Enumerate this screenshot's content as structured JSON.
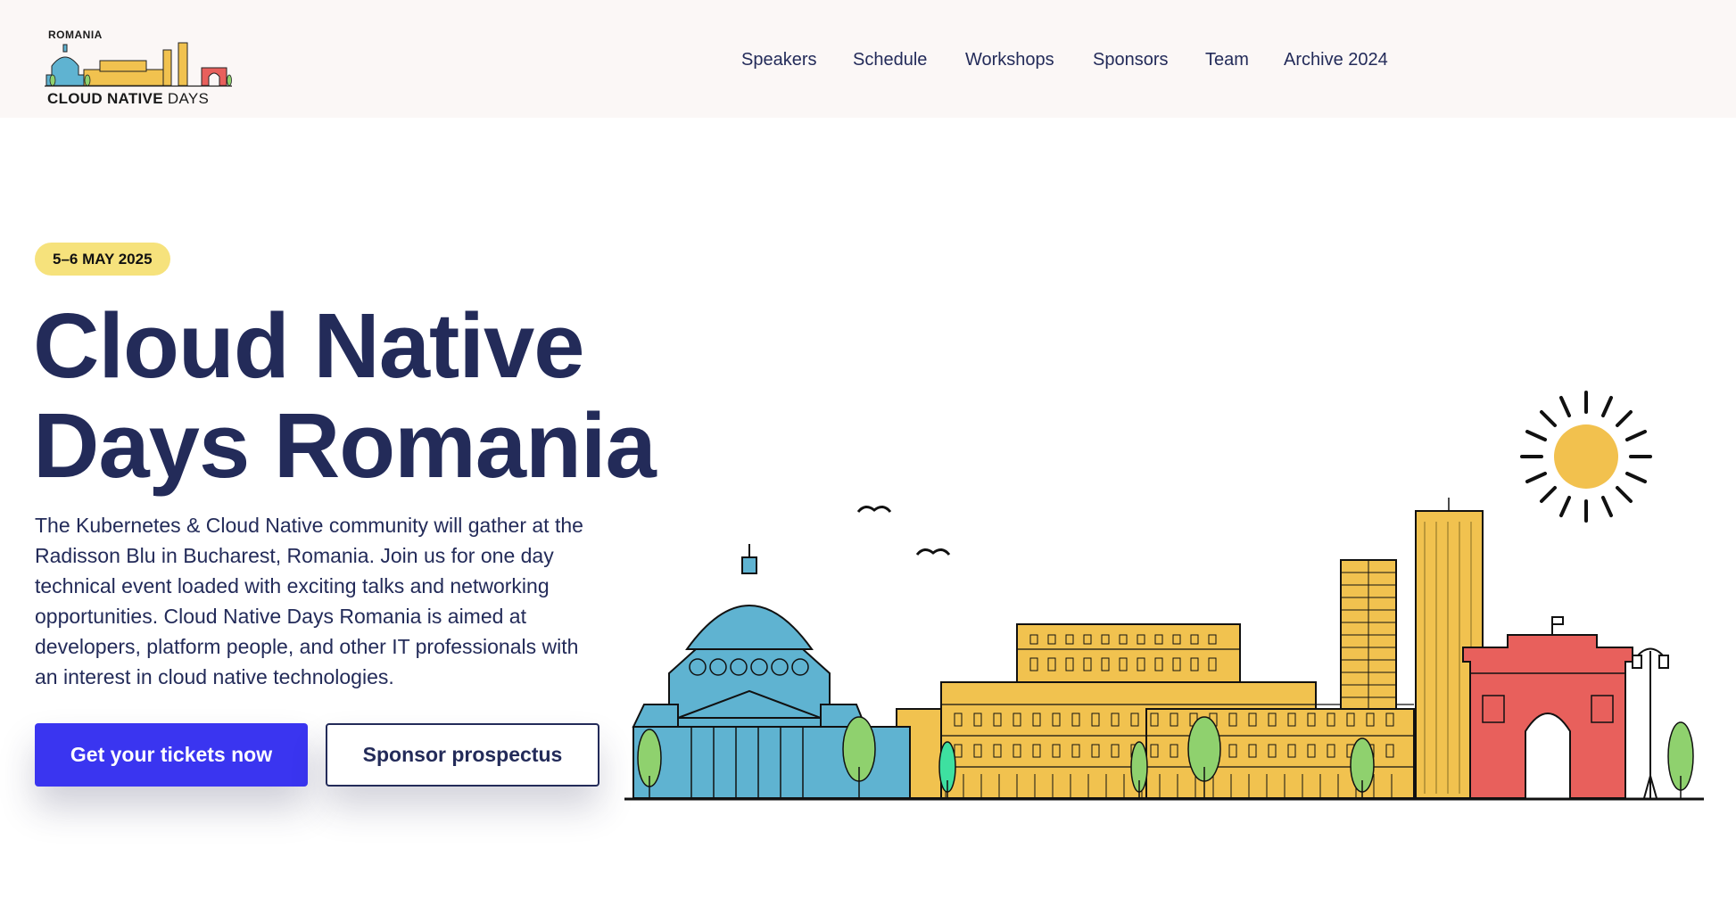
{
  "header": {
    "logo": {
      "country": "ROMANIA",
      "name_bold": "CLOUD NATIVE",
      "name_light": "DAYS"
    },
    "nav": [
      {
        "label": "Speakers"
      },
      {
        "label": "Schedule"
      },
      {
        "label": "Workshops"
      },
      {
        "label": "Sponsors"
      },
      {
        "label": "Team"
      },
      {
        "label": "Archive 2024"
      }
    ]
  },
  "hero": {
    "date_badge": "5–6 MAY 2025",
    "title_line1": "Cloud Native",
    "title_line2": "Days Romania",
    "description": "The Kubernetes & Cloud Native community will gather at the Radisson Blu in Bucharest, Romania. Join us for one day technical event loaded with exciting talks and networking opportunities. Cloud Native Days Romania is aimed at developers, platform people, and other IT professionals with an interest in cloud native technologies.",
    "primary_cta": "Get your tickets now",
    "secondary_cta": "Sponsor prospectus"
  },
  "colors": {
    "navy": "#232b59",
    "cta_blue": "#3a35f0",
    "badge_yellow": "#f6e27c",
    "nav_bg": "#fbf7f6",
    "athenaeum_blue": "#5fb3d1",
    "palace_yellow": "#f1c24f",
    "arch_red": "#e8605c",
    "tree_green": "#8fd16e",
    "sun_yellow": "#f2c14e"
  },
  "icons": {
    "logo": "cloud-native-days-skyline-logo",
    "illustration": "bucharest-skyline-illustration"
  }
}
